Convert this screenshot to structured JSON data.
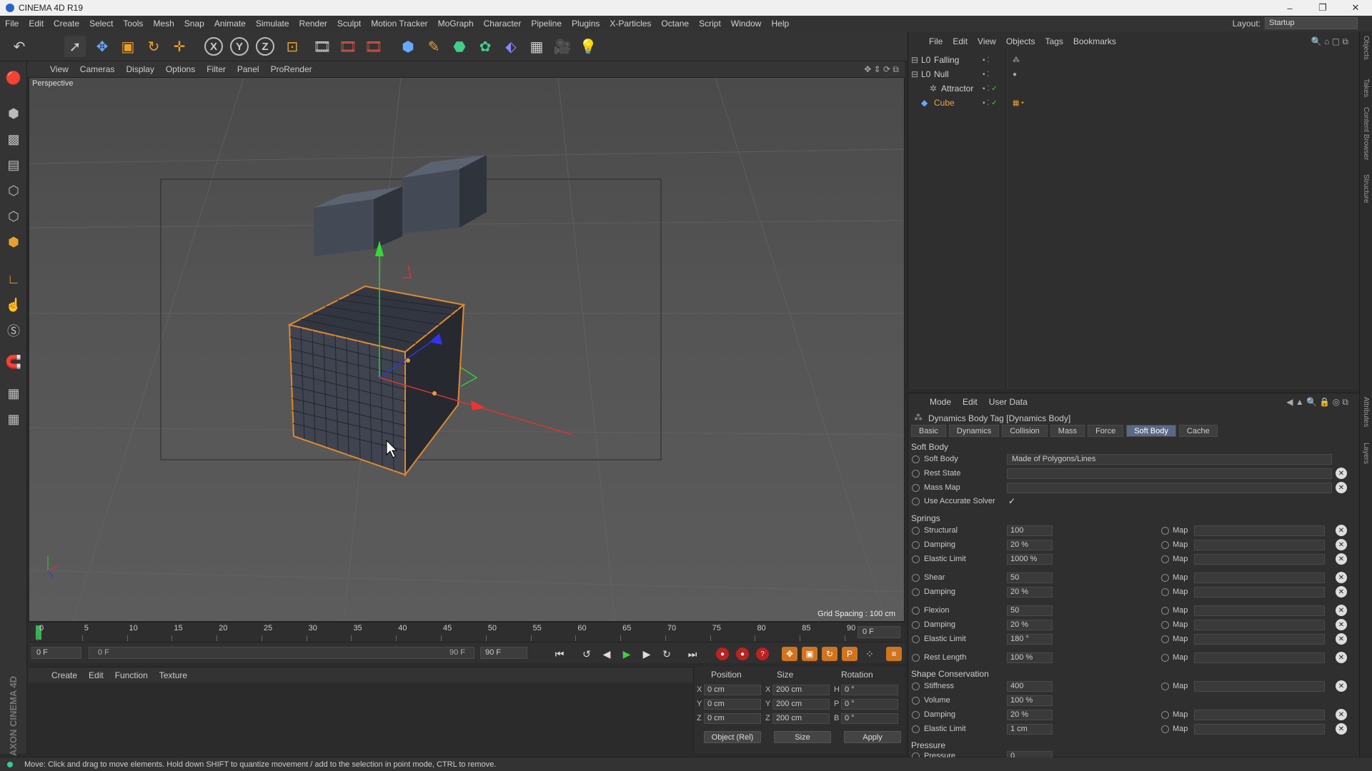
{
  "window": {
    "title": "CINEMA 4D R19",
    "controls": [
      "–",
      "❐",
      "✕"
    ]
  },
  "menu": [
    "File",
    "Edit",
    "Create",
    "Select",
    "Tools",
    "Mesh",
    "Snap",
    "Animate",
    "Simulate",
    "Render",
    "Sculpt",
    "Motion Tracker",
    "MoGraph",
    "Character",
    "Pipeline",
    "Plugins",
    "X-Particles",
    "Octane",
    "Script",
    "Window",
    "Help"
  ],
  "layout": {
    "label": "Layout:",
    "value": "Startup"
  },
  "viewport": {
    "menu": [
      "View",
      "Cameras",
      "Display",
      "Options",
      "Filter",
      "Panel",
      "ProRender"
    ],
    "name": "Perspective",
    "grid_spacing": "Grid Spacing : 100 cm"
  },
  "timeline": {
    "ticks": [
      "0",
      "5",
      "10",
      "15",
      "20",
      "25",
      "30",
      "35",
      "40",
      "45",
      "50",
      "55",
      "60",
      "65",
      "70",
      "75",
      "80",
      "85",
      "90"
    ],
    "current_frame": "0 F",
    "start_field": "0 F",
    "range_start": "0 F",
    "range_end": "90 F",
    "end_field": "90 F"
  },
  "material_manager": {
    "menu": [
      "Create",
      "Edit",
      "Function",
      "Texture"
    ]
  },
  "brand": "MAXON CINEMA 4D",
  "coordinates": {
    "headers": [
      "Position",
      "Size",
      "Rotation"
    ],
    "rows": [
      {
        "axis": "X",
        "pos": "0 cm",
        "size_axis": "X",
        "size": "200 cm",
        "rot_axis": "H",
        "rot": "0 °"
      },
      {
        "axis": "Y",
        "pos": "0 cm",
        "size_axis": "Y",
        "size": "200 cm",
        "rot_axis": "P",
        "rot": "0 °"
      },
      {
        "axis": "Z",
        "pos": "0 cm",
        "size_axis": "Z",
        "size": "200 cm",
        "rot_axis": "B",
        "rot": "0 °"
      }
    ],
    "mode": "Object (Rel)",
    "size_mode": "Size",
    "apply": "Apply"
  },
  "status": "Move: Click and drag to move elements. Hold down SHIFT to quantize movement / add to the selection in point mode, CTRL to remove.",
  "object_manager": {
    "menu": [
      "File",
      "Edit",
      "View",
      "Objects",
      "Tags",
      "Bookmarks"
    ],
    "objects": [
      {
        "name": "Falling",
        "icon": "L0"
      },
      {
        "name": "Null",
        "icon": "L0"
      },
      {
        "name": "Attractor",
        "icon": "✲"
      },
      {
        "name": "Cube",
        "icon": "◆"
      }
    ]
  },
  "right_tabs": [
    "Objects",
    "Takes",
    "Content Browser",
    "Structure",
    "Attributes",
    "Layers"
  ],
  "attributes": {
    "menu": [
      "Mode",
      "Edit",
      "User Data"
    ],
    "title": "Dynamics Body Tag [Dynamics Body]",
    "tabs": [
      "Basic",
      "Dynamics",
      "Collision",
      "Mass",
      "Force",
      "Soft Body",
      "Cache"
    ],
    "soft_body_section": "Soft Body",
    "soft_body_label": "Soft Body",
    "soft_body_value": "Made of Polygons/Lines",
    "rest_state": "Rest State",
    "mass_map": "Mass Map",
    "accurate_solver": "Use Accurate Solver",
    "accurate_solver_check": "✓",
    "springs_section": "Springs",
    "springs": [
      {
        "label": "Structural",
        "value": "100"
      },
      {
        "label": "Damping",
        "value": "20 %"
      },
      {
        "label": "Elastic Limit",
        "value": "1000 %"
      },
      {
        "label": "Shear",
        "value": "50"
      },
      {
        "label": "Damping",
        "value": "20 %"
      },
      {
        "label": "Flexion",
        "value": "50"
      },
      {
        "label": "Damping",
        "value": "20 %"
      },
      {
        "label": "Elastic Limit",
        "value": "180 °"
      },
      {
        "label": "Rest Length",
        "value": "100 %"
      }
    ],
    "map_label": "Map",
    "shape_section": "Shape Conservation",
    "shape": [
      {
        "label": "Stiffness",
        "value": "400"
      },
      {
        "label": "Volume",
        "value": "100 %"
      },
      {
        "label": "Damping",
        "value": "20 %"
      },
      {
        "label": "Elastic Limit",
        "value": "1 cm"
      }
    ],
    "pressure_section": "Pressure",
    "pressure": {
      "label": "Pressure",
      "value": "0"
    }
  }
}
